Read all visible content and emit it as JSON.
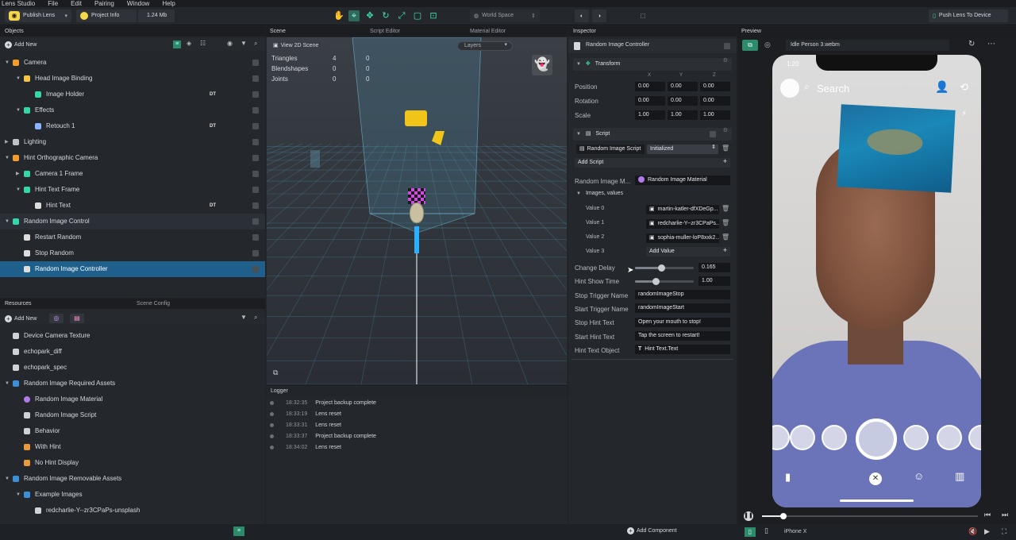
{
  "menu": [
    "Lens Studio",
    "File",
    "Edit",
    "Pairing",
    "Window",
    "Help"
  ],
  "toolbar": {
    "publish_label": "Publish Lens",
    "project_info_label": "Project Info",
    "size_label": "1.24 Mb",
    "space_label": "World Space",
    "push_label": "Push Lens To Device"
  },
  "objects": {
    "title": "Objects",
    "add_new": "Add New",
    "items": [
      {
        "label": "Camera",
        "depth": 0,
        "expanded": true
      },
      {
        "label": "Head Image Binding",
        "depth": 1,
        "expanded": true
      },
      {
        "label": "Image Holder",
        "depth": 2,
        "tag": "DT"
      },
      {
        "label": "Effects",
        "depth": 1,
        "expanded": true
      },
      {
        "label": "Retouch 1",
        "depth": 2,
        "tag": "DT"
      },
      {
        "label": "Lighting",
        "depth": 0,
        "expanded": false
      },
      {
        "label": "Hint Orthographic Camera",
        "depth": 0,
        "expanded": true
      },
      {
        "label": "Camera 1 Frame",
        "depth": 1,
        "expanded": false
      },
      {
        "label": "Hint Text Frame",
        "depth": 1,
        "expanded": true
      },
      {
        "label": "Hint Text",
        "depth": 2,
        "tag": "DT"
      },
      {
        "label": "Random Image Control",
        "depth": 0,
        "expanded": true
      },
      {
        "label": "Restart Random",
        "depth": 1
      },
      {
        "label": "Stop Random",
        "depth": 1
      },
      {
        "label": "Random Image Controller",
        "depth": 1
      }
    ]
  },
  "resources": {
    "tab1": "Resources",
    "tab2": "Scene Config",
    "add_new": "Add New",
    "items": [
      {
        "label": "Device Camera Texture",
        "depth": 0
      },
      {
        "label": "echopark_diff",
        "depth": 0
      },
      {
        "label": "echopark_spec",
        "depth": 0
      },
      {
        "label": "Random Image Required Assets",
        "depth": 0,
        "folder": true
      },
      {
        "label": "Random Image Material",
        "depth": 1
      },
      {
        "label": "Random Image Script",
        "depth": 1
      },
      {
        "label": "Behavior",
        "depth": 1
      },
      {
        "label": "With Hint",
        "depth": 1
      },
      {
        "label": "No Hint Display",
        "depth": 1
      },
      {
        "label": "Random Image Removable Assets",
        "depth": 0,
        "folder": true
      },
      {
        "label": "Example Images",
        "depth": 1,
        "folder": true
      },
      {
        "label": "redcharlie-Y--zr3CPaPs-unsplash",
        "depth": 2
      }
    ]
  },
  "scene": {
    "tab_scene": "Scene",
    "tab_script": "Script Editor",
    "tab_material": "Material Editor",
    "view2d": "View 2D Scene",
    "layers": "Layers",
    "stats": [
      {
        "label": "Triangles",
        "a": "4",
        "b": "0"
      },
      {
        "label": "Blendshapes",
        "a": "0",
        "b": "0"
      },
      {
        "label": "Joints",
        "a": "0",
        "b": "0"
      }
    ]
  },
  "logger": {
    "title": "Logger",
    "entries": [
      {
        "time": "18:32:35",
        "msg": "Project backup complete"
      },
      {
        "time": "18:33:19",
        "msg": "Lens reset"
      },
      {
        "time": "18:33:31",
        "msg": "Lens reset"
      },
      {
        "time": "18:33:37",
        "msg": "Project backup complete"
      },
      {
        "time": "18:34:02",
        "msg": "Lens reset"
      }
    ]
  },
  "inspector": {
    "title": "Inspector",
    "object_name": "Random Image Controller",
    "transform": "Transform",
    "axes": [
      "X",
      "Y",
      "Z"
    ],
    "position_label": "Position",
    "rotation_label": "Rotation",
    "scale_label": "Scale",
    "position": [
      "0.00",
      "0.00",
      "0.00"
    ],
    "rotation": [
      "0.00",
      "0.00",
      "0.00"
    ],
    "scale": [
      "1.00",
      "1.00",
      "1.00"
    ],
    "script": "Script",
    "script_asset": "Random Image Script",
    "script_event": "Initialized",
    "add_script": "Add Script",
    "material_label": "Random Image M...",
    "material_value": "Random Image Material",
    "images_label": "Images, values",
    "values": [
      {
        "label": "Value 0",
        "value": "martin-katler-dfXDeGp..."
      },
      {
        "label": "Value 1",
        "value": "redcharlie-Y--zr3CPaPs..."
      },
      {
        "label": "Value 2",
        "value": "sophia-muller-loP8xxk2..."
      }
    ],
    "value3_label": "Value 3",
    "add_value": "Add Value",
    "change_delay_label": "Change Delay",
    "change_delay": "0.165",
    "change_delay_level": 0.45,
    "hint_show_label": "Hint Show Time",
    "hint_show": "1.00",
    "hint_show_level": 0.35,
    "stop_trigger_label": "Stop Trigger Name",
    "stop_trigger": "randomImageStop",
    "start_trigger_label": "Start Trigger Name",
    "start_trigger": "randomImageStart",
    "stop_hint_label": "Stop Hint Text",
    "stop_hint": "Open your mouth to stop!",
    "start_hint_label": "Start Hint Text",
    "start_hint": "Tap the screen to restart!",
    "hint_obj_label": "Hint Text Object",
    "hint_obj": "Hint Text.Text",
    "add_component": "Add Component"
  },
  "preview": {
    "title": "Preview",
    "video": "Idle Person 3.webm",
    "phone_time": "1:20",
    "search": "Search",
    "device": "iPhone X",
    "playback_level": 0.1
  },
  "colors": {
    "accent": "#3fe0b0",
    "selection": "#1f5f8c",
    "shirt": "#6b74b8"
  }
}
